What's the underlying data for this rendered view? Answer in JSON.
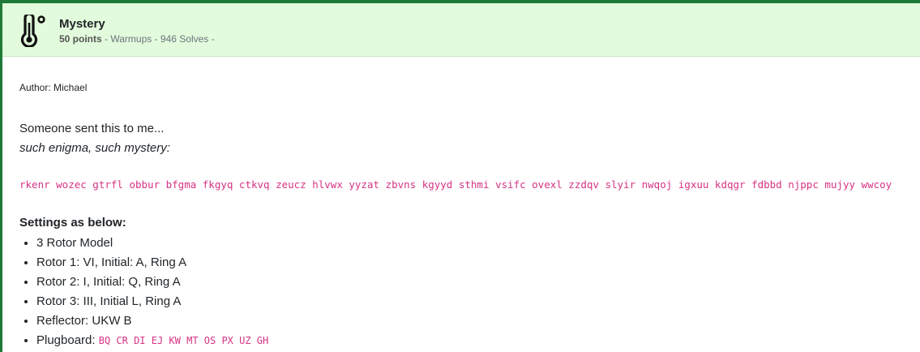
{
  "challenge": {
    "title": "Mystery",
    "points": "50 points",
    "meta_rest": " - Warmups - 946 Solves -",
    "icon": "thermometer-icon"
  },
  "author": "Author: Michael",
  "intro": {
    "line1": "Someone sent this to me...",
    "line2": "such enigma, such mystery:"
  },
  "ciphertext": "rkenr wozec gtrfl obbur bfgma fkgyq ctkvq zeucz hlvwx yyzat zbvns kgyyd sthmi vsifc ovexl zzdqv slyir nwqoj igxuu kdqgr fdbbd njppc mujyy wwcoy",
  "settings": {
    "heading": "Settings as below:",
    "items": [
      "3 Rotor Model",
      "Rotor 1: VI, Initial: A, Ring A",
      "Rotor 2: I, Initial: Q, Ring A",
      "Rotor 3: III, Initial L, Ring A",
      "Reflector: UKW B"
    ],
    "plugboard_label": "Plugboard: ",
    "plugboard_value": "BQ CR DI EJ KW MT OS PX UZ GH"
  },
  "colors": {
    "header_bg": "#e2fbdc",
    "accent_border": "#1f7a38",
    "code_pink": "#d63384"
  }
}
